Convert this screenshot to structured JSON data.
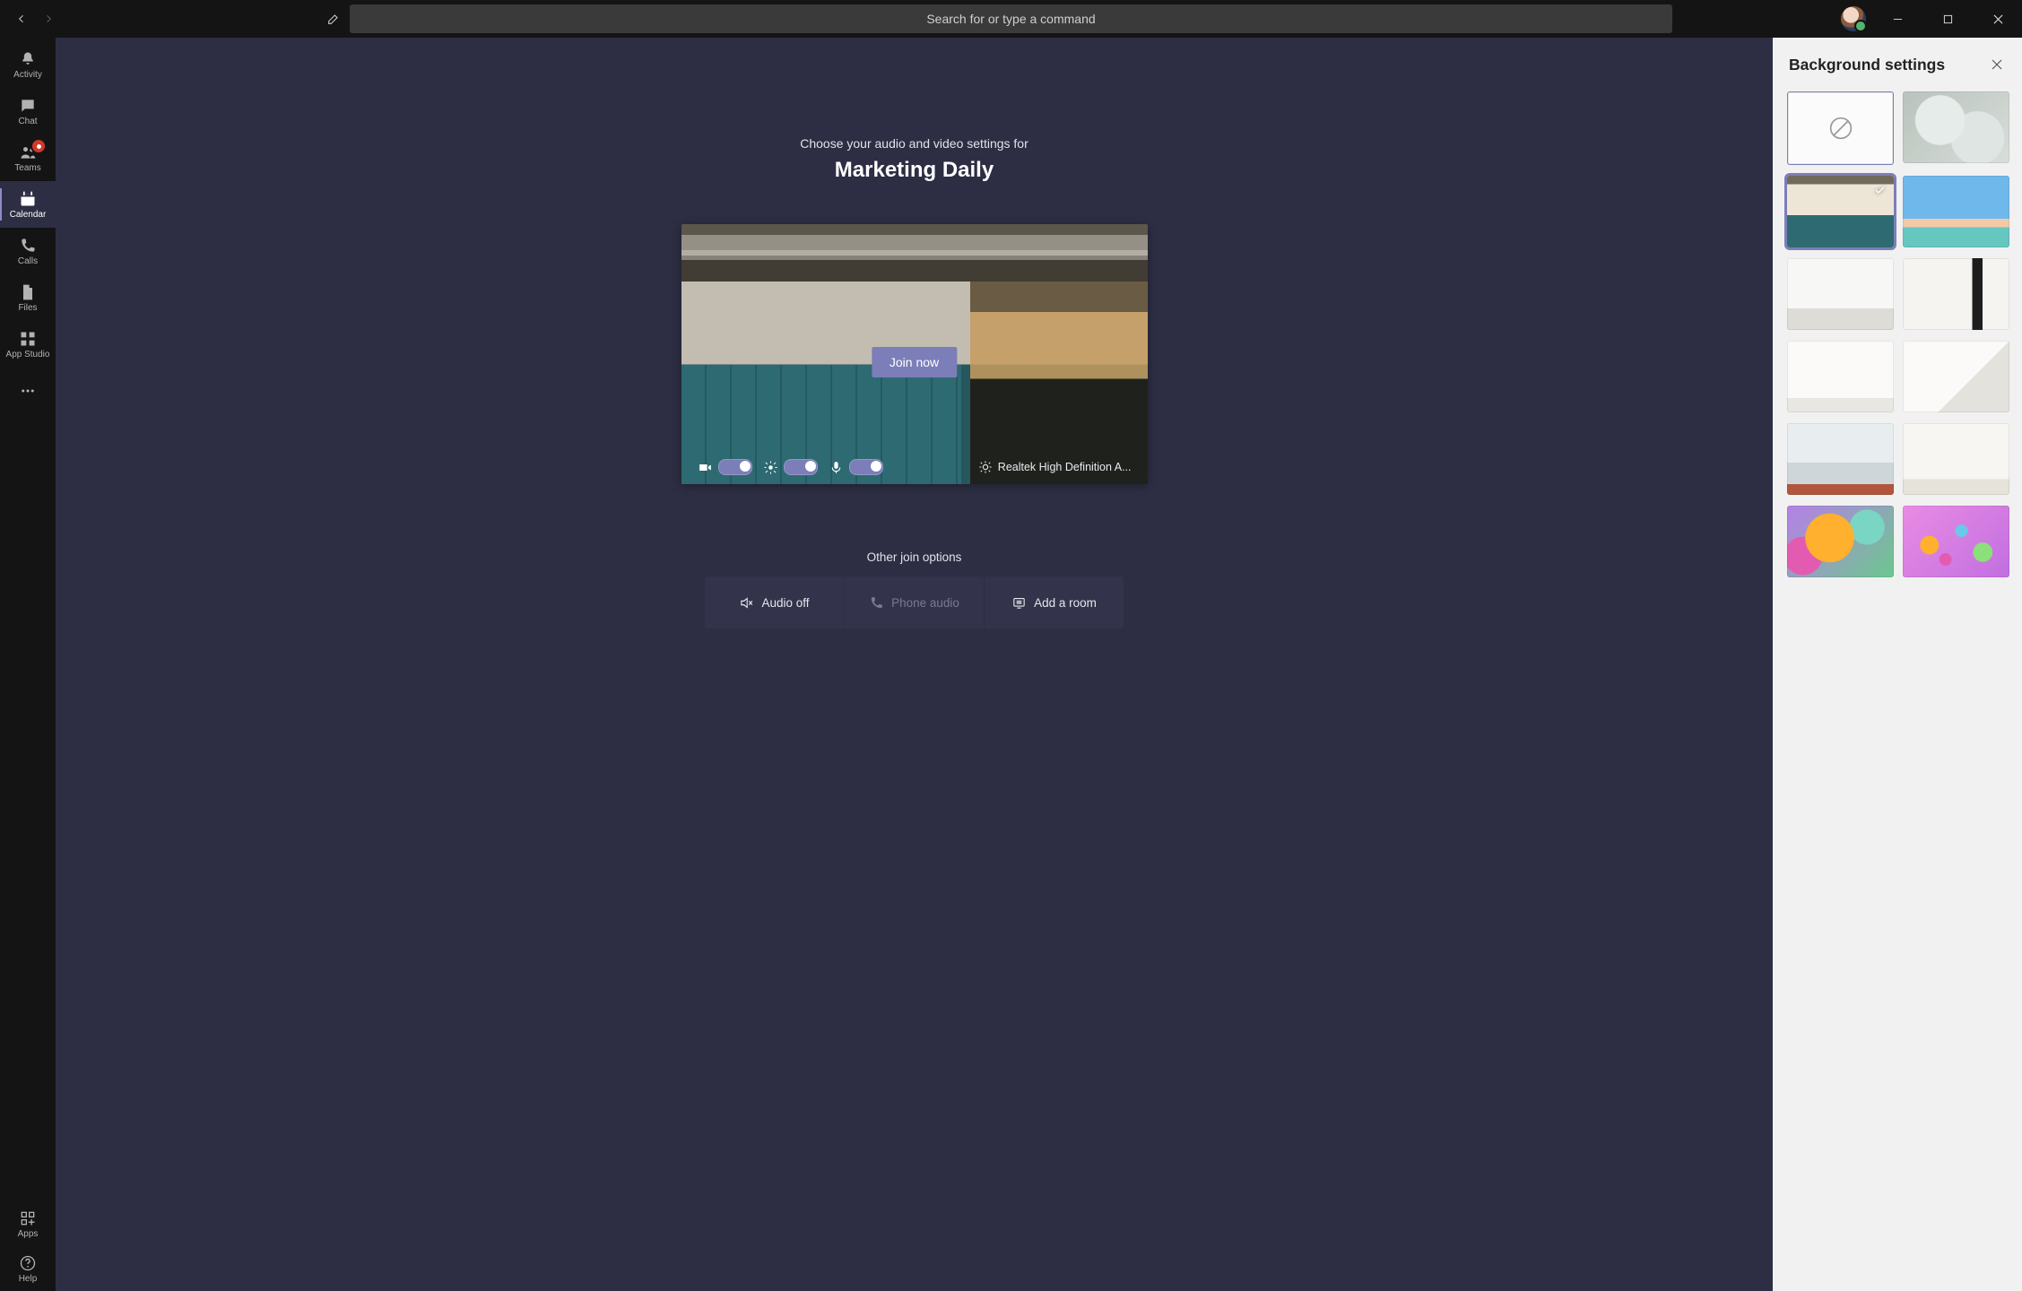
{
  "titlebar": {
    "search_placeholder": "Search for or type a command"
  },
  "rail": {
    "items": [
      {
        "id": "activity",
        "label": "Activity",
        "icon": "bell",
        "badge": false,
        "active": false
      },
      {
        "id": "chat",
        "label": "Chat",
        "icon": "chat",
        "badge": false,
        "active": false
      },
      {
        "id": "teams",
        "label": "Teams",
        "icon": "teams",
        "badge": true,
        "active": false
      },
      {
        "id": "calendar",
        "label": "Calendar",
        "icon": "calendar",
        "badge": false,
        "active": true
      },
      {
        "id": "calls",
        "label": "Calls",
        "icon": "phone",
        "badge": false,
        "active": false
      },
      {
        "id": "files",
        "label": "Files",
        "icon": "file",
        "badge": false,
        "active": false
      },
      {
        "id": "appstudio",
        "label": "App Studio",
        "icon": "grid",
        "badge": false,
        "active": false
      }
    ],
    "bottom": [
      {
        "id": "apps",
        "label": "Apps",
        "icon": "apps"
      },
      {
        "id": "help",
        "label": "Help",
        "icon": "help"
      }
    ]
  },
  "prejoin": {
    "subtitle": "Choose your audio and video settings for",
    "meeting_title": "Marketing Daily",
    "join_label": "Join now",
    "device_label": "Realtek High Definition A...",
    "toggles": {
      "camera_on": true,
      "background_on": true,
      "mic_on": true
    },
    "other_label": "Other join options",
    "other_options": [
      {
        "id": "audio-off",
        "label": "Audio off",
        "icon": "speaker-off",
        "disabled": false
      },
      {
        "id": "phone-audio",
        "label": "Phone audio",
        "icon": "phone",
        "disabled": true
      },
      {
        "id": "add-room",
        "label": "Add a room",
        "icon": "room",
        "disabled": false
      }
    ]
  },
  "panel": {
    "title": "Background settings",
    "backgrounds": [
      {
        "id": "none",
        "kind": "none",
        "selected": false
      },
      {
        "id": "blur",
        "kind": "blur",
        "selected": false
      },
      {
        "id": "img1",
        "kind": "image",
        "class": "image-1",
        "selected": true
      },
      {
        "id": "img2",
        "kind": "image",
        "class": "image-2",
        "selected": false
      },
      {
        "id": "img3",
        "kind": "image",
        "class": "image-3",
        "selected": false
      },
      {
        "id": "img4",
        "kind": "image",
        "class": "image-4",
        "selected": false
      },
      {
        "id": "img5",
        "kind": "image",
        "class": "image-5",
        "selected": false
      },
      {
        "id": "img6",
        "kind": "image",
        "class": "image-6",
        "selected": false
      },
      {
        "id": "img7",
        "kind": "image",
        "class": "image-7",
        "selected": false
      },
      {
        "id": "img8",
        "kind": "image",
        "class": "image-8",
        "selected": false
      },
      {
        "id": "img9",
        "kind": "image",
        "class": "image-9",
        "selected": false
      },
      {
        "id": "img10",
        "kind": "image",
        "class": "image-10",
        "selected": false
      }
    ]
  },
  "colors": {
    "accent": "#7b7eb8",
    "surface_dark": "#2d2e43",
    "rail": "#141414"
  }
}
